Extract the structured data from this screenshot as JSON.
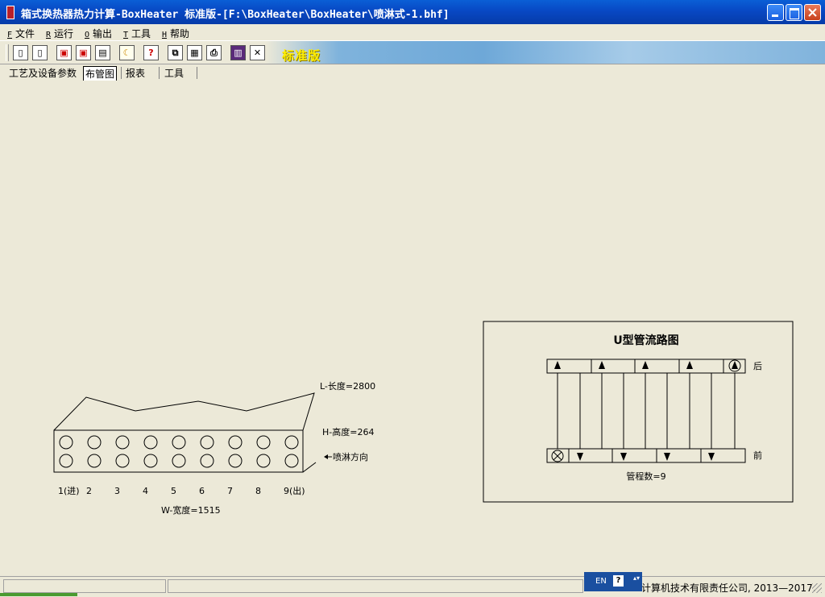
{
  "window": {
    "title": "箱式换热器热力计算-BoxHeater 标准版-[F:\\BoxHeater\\BoxHeater\\喷淋式-1.bhf]"
  },
  "menu": [
    {
      "hotkey": "F",
      "label": "文件"
    },
    {
      "hotkey": "R",
      "label": "运行"
    },
    {
      "hotkey": "O",
      "label": "输出"
    },
    {
      "hotkey": "T",
      "label": "工具"
    },
    {
      "hotkey": "H",
      "label": "帮助"
    }
  ],
  "toolbar": {
    "badge": "标准版",
    "help_glyph": "?"
  },
  "tabs": [
    {
      "label": "工艺及设备参数"
    },
    {
      "label": "布管图"
    },
    {
      "label": "报表"
    },
    {
      "label": "工具"
    }
  ],
  "box_diagram": {
    "length_label": "L-长度=2800",
    "height_label": "H-高度=264",
    "spray_label": "喷淋方向",
    "width_label": "W-宽度=1515",
    "columns": [
      "1(进)",
      "2",
      "3",
      "4",
      "5",
      "6",
      "7",
      "8",
      "9(出)"
    ],
    "rows": 2
  },
  "flow_diagram": {
    "title": "U型管流路图",
    "back_label": "后",
    "front_label": "前",
    "pass_count_label": "管程数=9"
  },
  "statusbar": {
    "company": "计算机技术有限责任公司, 2013—2017.",
    "ime_lang": "EN",
    "ime_help": "?"
  }
}
